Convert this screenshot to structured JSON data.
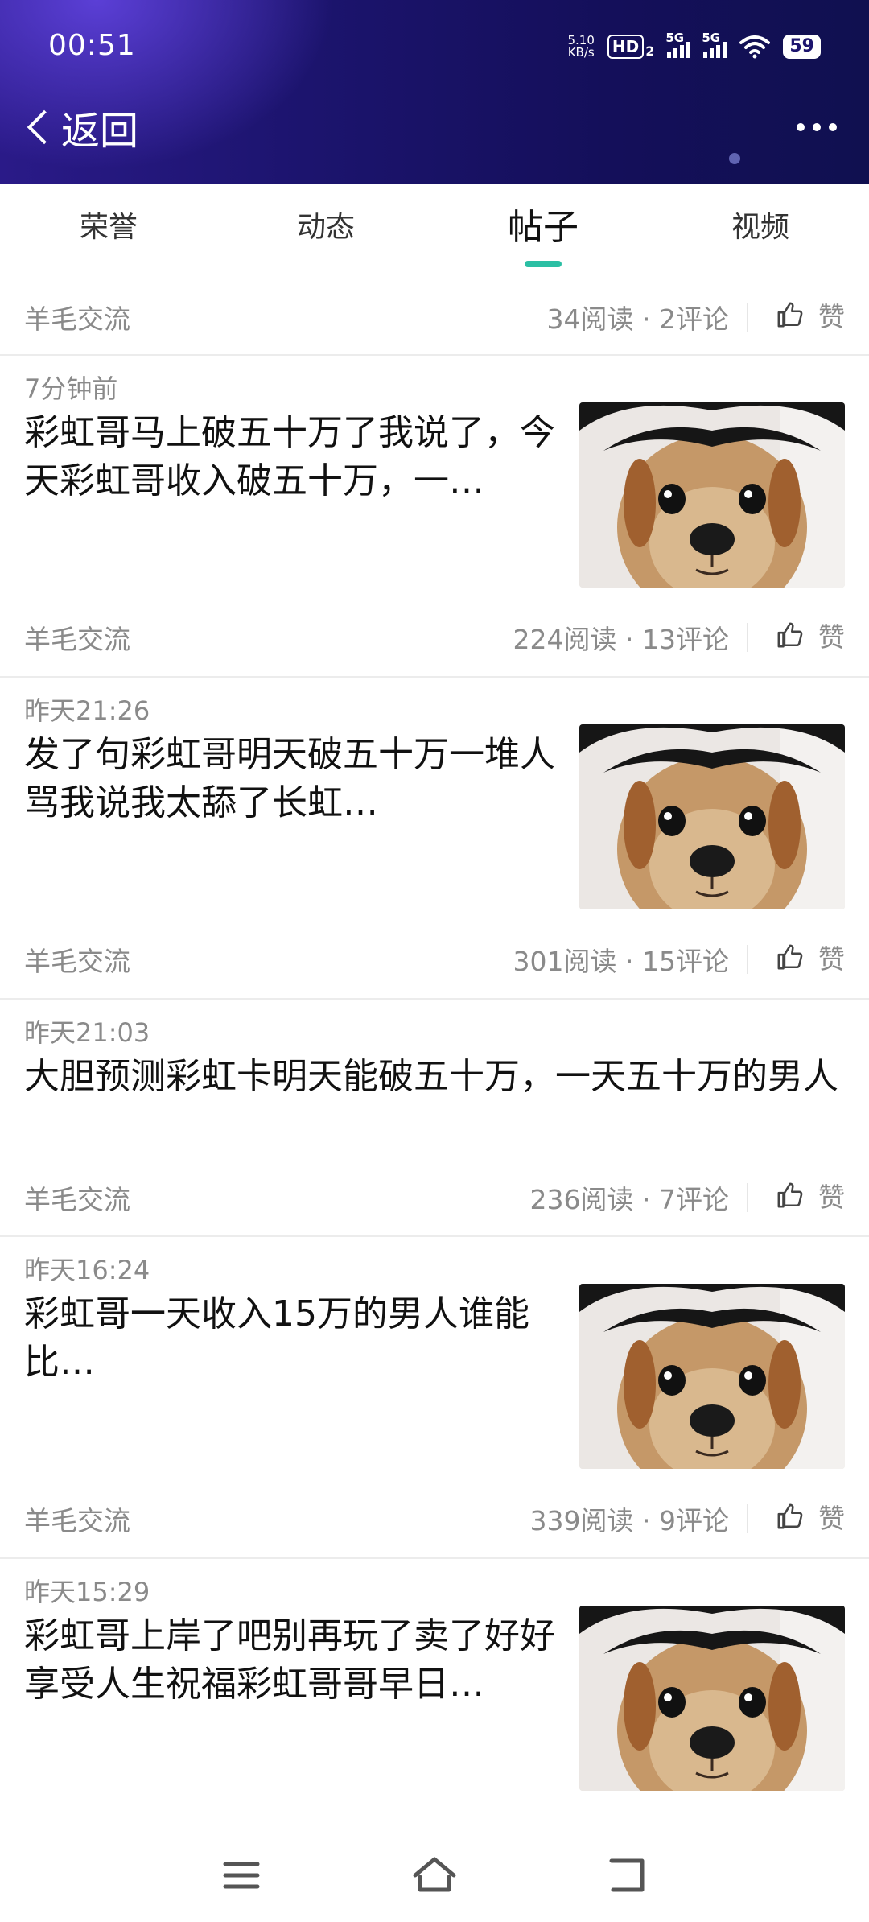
{
  "status": {
    "time": "00:51",
    "net_speed_value": "5.10",
    "net_speed_unit": "KB/s",
    "hd_label": "HD",
    "hd_sub": "2",
    "sim1_label": "5G",
    "sim2_label": "5G",
    "battery": "59"
  },
  "nav": {
    "back_label": "返回"
  },
  "tabs": [
    {
      "label": "荣誉"
    },
    {
      "label": "动态"
    },
    {
      "label": "帖子"
    },
    {
      "label": "视频"
    }
  ],
  "top_meta": {
    "group": "羊毛交流",
    "stats": "34阅读 · 2评论",
    "like": "赞"
  },
  "posts": [
    {
      "time": "7分钟前",
      "title": "彩虹哥马上破五十万了我说了，今天彩虹哥收入破五十万，一…",
      "group": "羊毛交流",
      "stats": "224阅读 · 13评论",
      "like": "赞"
    },
    {
      "time": "昨天21:26",
      "title": "发了句彩虹哥明天破五十万一堆人骂我说我太舔了长虹…",
      "group": "羊毛交流",
      "stats": "301阅读 · 15评论",
      "like": "赞"
    },
    {
      "time": "昨天21:03",
      "title": "大胆预测彩虹卡明天能破五十万，一天五十万的男人",
      "group": "羊毛交流",
      "stats": "236阅读 · 7评论",
      "like": "赞"
    },
    {
      "time": "昨天16:24",
      "title": "彩虹哥一天收入15万的男人谁能比…",
      "group": "羊毛交流",
      "stats": "339阅读 · 9评论",
      "like": "赞"
    },
    {
      "time": "昨天15:29",
      "title": "彩虹哥上岸了吧别再玩了卖了好好享受人生祝福彩虹哥哥早日…"
    }
  ],
  "colors": {
    "accent": "#2bbfa4",
    "header_dark": "#140f5a",
    "header_light": "#5b3fd6",
    "meta_gray": "#8a8a8a"
  }
}
